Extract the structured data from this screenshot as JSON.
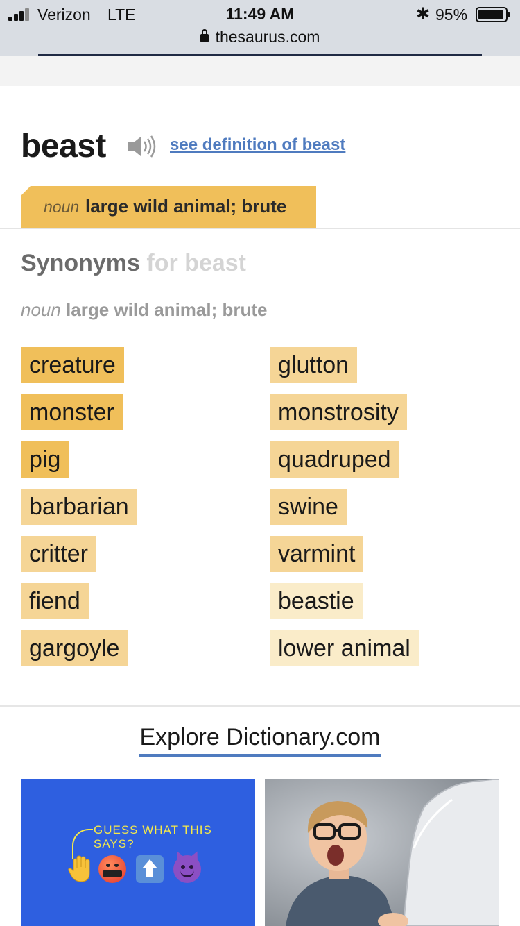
{
  "status_bar": {
    "carrier": "Verizon",
    "network": "LTE",
    "time": "11:49 AM",
    "battery_percent": "95%",
    "battery_level": 0.95,
    "url": "thesaurus.com"
  },
  "entry": {
    "word": "beast",
    "definition_link": "see definition of beast"
  },
  "sense_tab": {
    "pos": "noun",
    "definition": "large wild animal; brute"
  },
  "synonyms_section": {
    "heading": "Synonyms",
    "heading_suffix": "for beast",
    "sense_pos": "noun",
    "sense_definition": "large wild animal; brute"
  },
  "synonyms": {
    "left": [
      {
        "word": "creature",
        "relevance": "high"
      },
      {
        "word": "monster",
        "relevance": "high"
      },
      {
        "word": "pig",
        "relevance": "high"
      },
      {
        "word": "barbarian",
        "relevance": "medium"
      },
      {
        "word": "critter",
        "relevance": "medium"
      },
      {
        "word": "fiend",
        "relevance": "medium"
      },
      {
        "word": "gargoyle",
        "relevance": "medium"
      }
    ],
    "right": [
      {
        "word": "glutton",
        "relevance": "medium"
      },
      {
        "word": "monstrosity",
        "relevance": "medium"
      },
      {
        "word": "quadruped",
        "relevance": "medium"
      },
      {
        "word": "swine",
        "relevance": "medium"
      },
      {
        "word": "varmint",
        "relevance": "medium"
      },
      {
        "word": "beastie",
        "relevance": "low"
      },
      {
        "word": "lower animal",
        "relevance": "low"
      }
    ],
    "colors": {
      "high": "#f0bf5a",
      "medium": "#f5d596",
      "low": "#faecc9"
    }
  },
  "explore": {
    "title": "Explore Dictionary.com"
  },
  "promo_cards": [
    {
      "text": "GUESS WHAT THIS SAYS?",
      "symbols": "&$!#%",
      "icons": [
        "raised-hand-icon",
        "cursing-face-icon",
        "up-arrow-icon",
        "smiling-devil-icon"
      ]
    },
    {
      "image": "surprised-boy-with-laptop"
    }
  ],
  "colors": {
    "link": "#4f7bbf",
    "accent": "#f0bf5a"
  }
}
